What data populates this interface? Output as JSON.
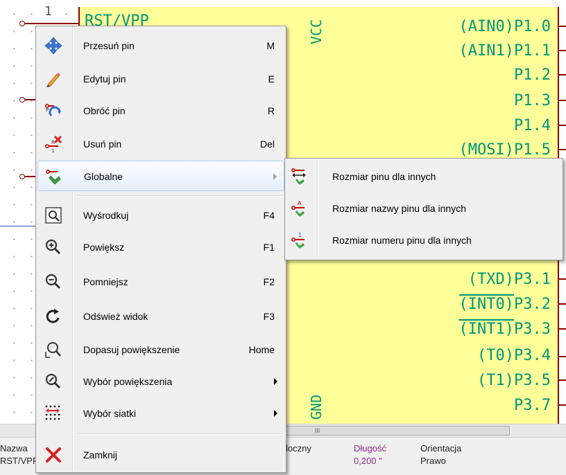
{
  "schematic": {
    "top_pin_number": "1",
    "left_label": "RST/VPP",
    "vcc": "VCC",
    "gnd": "GND",
    "right_pins": [
      "(AIN0)P1.0",
      "(AIN1)P1.1",
      "P1.2",
      "P1.3",
      "P1.4",
      "(MOSI)P1.5"
    ],
    "right_pins_lower": [
      {
        "prefix": "(TXD)",
        "suffix": "P3.1",
        "overline": false
      },
      {
        "prefix": "(INT0)",
        "suffix": "P3.2",
        "overline": true
      },
      {
        "prefix": "(INT1)",
        "suffix": "P3.3",
        "overline": true
      },
      {
        "prefix": "(T0)",
        "suffix": "P3.4",
        "overline": false
      },
      {
        "prefix": "(T1)",
        "suffix": "P3.5",
        "overline": false
      },
      {
        "prefix": "",
        "suffix": "P3.7",
        "overline": false
      }
    ],
    "colors": {
      "body": "#ffff99",
      "pin": "#8b0000",
      "text": "#00967d"
    }
  },
  "scrollbar": {
    "thumb_glyph": "III"
  },
  "status_bar": {
    "name_label": "Nazwa",
    "name_value": "RST/VPP",
    "type_fragment": "loczny",
    "length_label": "Długość",
    "length_value": "0,200 \"",
    "orientation_label": "Orientacja",
    "orientation_value": "Prawo"
  },
  "context_menu": {
    "items": [
      {
        "label": "Przesuń pin",
        "shortcut": "M",
        "icon": "move-icon"
      },
      {
        "label": "Edytuj pin",
        "shortcut": "E",
        "icon": "pencil-icon"
      },
      {
        "label": "Obróć pin",
        "shortcut": "R",
        "icon": "rotate-pin-icon"
      },
      {
        "label": "Usuń pin",
        "shortcut": "Del",
        "icon": "delete-pin-icon"
      },
      {
        "label": "Globalne",
        "shortcut": "",
        "icon": "global-pin-icon",
        "submenu": true,
        "highlighted": true
      },
      {
        "label": "Wyśrodkuj",
        "shortcut": "F4",
        "icon": "center-icon"
      },
      {
        "label": "Powiększ",
        "shortcut": "F1",
        "icon": "zoom-in-icon"
      },
      {
        "label": "Pomniejsz",
        "shortcut": "F2",
        "icon": "zoom-out-icon"
      },
      {
        "label": "Odśwież widok",
        "shortcut": "F3",
        "icon": "refresh-icon"
      },
      {
        "label": "Dopasuj powiększenie",
        "shortcut": "Home",
        "icon": "zoom-fit-icon"
      },
      {
        "label": "Wybór powiększenia",
        "shortcut": "",
        "icon": "zoom-select-icon",
        "submenu": true
      },
      {
        "label": "Wybór siatki",
        "shortcut": "",
        "icon": "grid-icon",
        "submenu": true
      },
      {
        "label": "Zamknij",
        "shortcut": "",
        "icon": "close-icon"
      }
    ]
  },
  "submenu": {
    "items": [
      {
        "label": "Rozmiar pinu dla innych",
        "icon": "pin-size-icon"
      },
      {
        "label": "Rozmiar nazwy pinu dla innych",
        "icon": "pin-name-size-icon"
      },
      {
        "label": "Rozmiar numeru pinu dla innych",
        "icon": "pin-number-size-icon"
      }
    ]
  }
}
